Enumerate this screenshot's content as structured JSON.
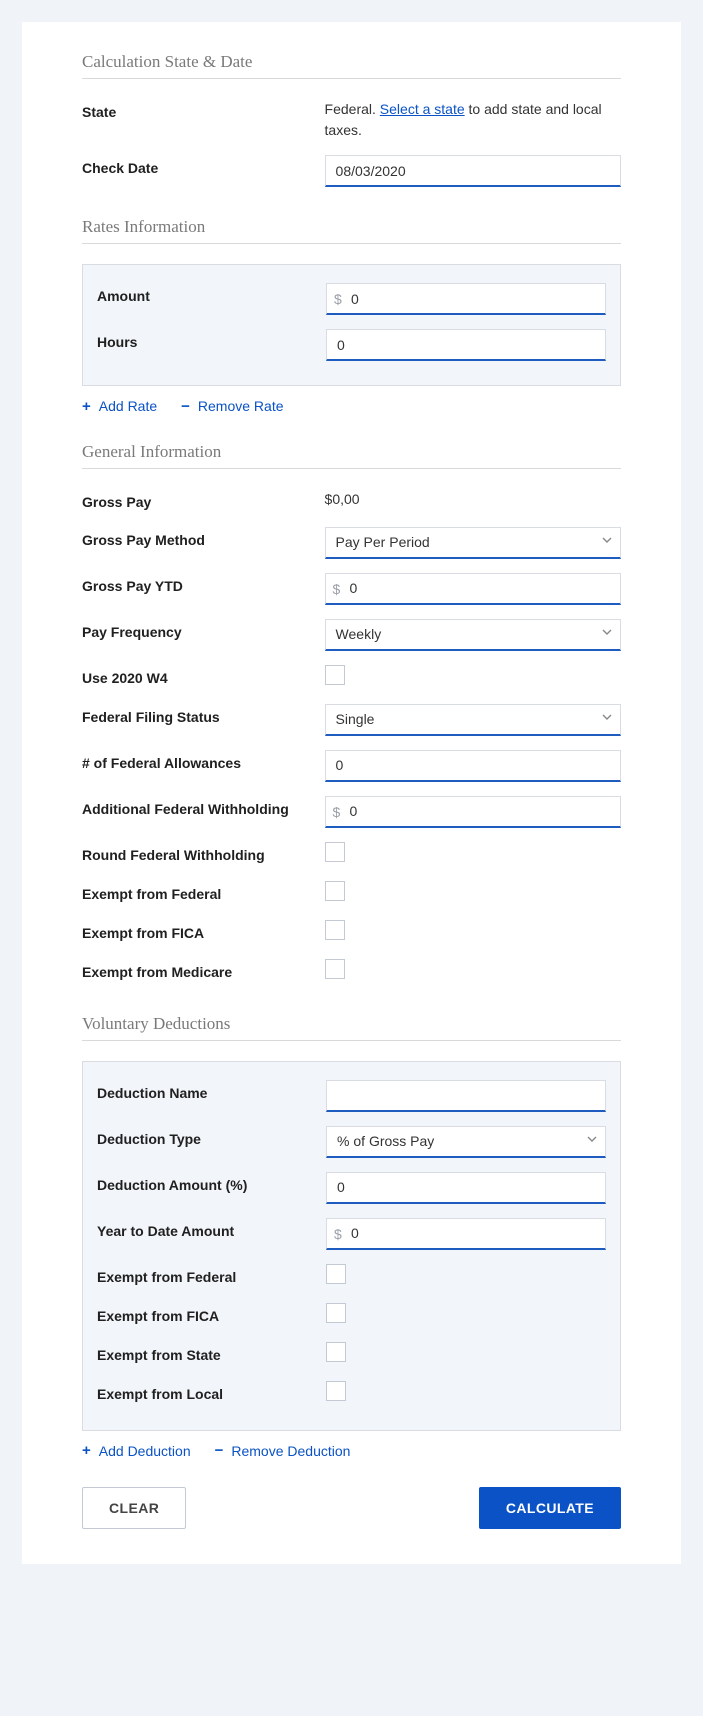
{
  "sections": {
    "calc_state_date": {
      "title": "Calculation State & Date",
      "state_label": "State",
      "state_text_prefix": "Federal. ",
      "state_link": "Select a state",
      "state_text_suffix": " to add state and local taxes.",
      "check_date_label": "Check Date",
      "check_date_value": "08/03/2020"
    },
    "rates": {
      "title": "Rates Information",
      "amount_label": "Amount",
      "amount_value": "0",
      "hours_label": "Hours",
      "hours_value": "0",
      "add_rate": "Add Rate",
      "remove_rate": "Remove Rate"
    },
    "general": {
      "title": "General Information",
      "gross_pay_label": "Gross Pay",
      "gross_pay_value": "$0,00",
      "gross_method_label": "Gross Pay Method",
      "gross_method_value": "Pay Per Period",
      "gross_ytd_label": "Gross Pay YTD",
      "gross_ytd_value": "0",
      "pay_freq_label": "Pay Frequency",
      "pay_freq_value": "Weekly",
      "use_w4_label": "Use 2020 W4",
      "filing_status_label": "Federal Filing Status",
      "filing_status_value": "Single",
      "allowances_label": "# of Federal Allowances",
      "allowances_value": "0",
      "addl_withholding_label": "Additional Federal Withholding",
      "addl_withholding_value": "0",
      "round_withholding_label": "Round Federal Withholding",
      "exempt_federal_label": "Exempt from Federal",
      "exempt_fica_label": "Exempt from FICA",
      "exempt_medicare_label": "Exempt from Medicare"
    },
    "deductions": {
      "title": "Voluntary Deductions",
      "name_label": "Deduction Name",
      "name_value": "",
      "type_label": "Deduction Type",
      "type_value": "% of Gross Pay",
      "amount_label": "Deduction Amount (%)",
      "amount_value": "0",
      "ytd_label": "Year to Date Amount",
      "ytd_value": "0",
      "exempt_federal_label": "Exempt from Federal",
      "exempt_fica_label": "Exempt from FICA",
      "exempt_state_label": "Exempt from State",
      "exempt_local_label": "Exempt from Local",
      "add_deduction": "Add Deduction",
      "remove_deduction": "Remove Deduction"
    }
  },
  "buttons": {
    "clear": "CLEAR",
    "calculate": "CALCULATE"
  },
  "currency_prefix": "$"
}
